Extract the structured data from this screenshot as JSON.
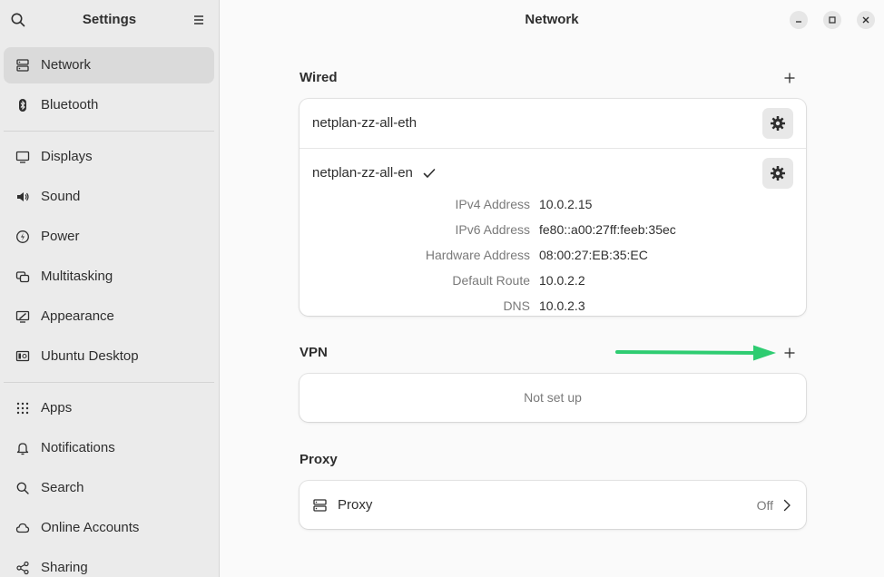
{
  "sidebar": {
    "title": "Settings",
    "search_icon": "search-icon",
    "menu_icon": "hamburger-menu-icon",
    "group1": [
      {
        "label": "Network",
        "icon": "network-icon",
        "active": true
      },
      {
        "label": "Bluetooth",
        "icon": "bluetooth-icon",
        "active": false
      }
    ],
    "group2": [
      {
        "label": "Displays",
        "icon": "display-icon"
      },
      {
        "label": "Sound",
        "icon": "speaker-icon"
      },
      {
        "label": "Power",
        "icon": "power-icon"
      },
      {
        "label": "Multitasking",
        "icon": "multitasking-icon"
      },
      {
        "label": "Appearance",
        "icon": "appearance-icon"
      },
      {
        "label": "Ubuntu Desktop",
        "icon": "ubuntu-desktop-icon"
      }
    ],
    "group3": [
      {
        "label": "Apps",
        "icon": "apps-grid-icon"
      },
      {
        "label": "Notifications",
        "icon": "bell-icon"
      },
      {
        "label": "Search",
        "icon": "search-icon"
      },
      {
        "label": "Online Accounts",
        "icon": "cloud-icon"
      },
      {
        "label": "Sharing",
        "icon": "share-icon"
      }
    ]
  },
  "main": {
    "title": "Network",
    "window_controls": [
      "minimize-icon",
      "maximize-icon",
      "close-icon"
    ],
    "wired": {
      "title": "Wired",
      "connections": [
        {
          "name": "netplan-zz-all-eth",
          "active": false
        },
        {
          "name": "netplan-zz-all-en",
          "active": true
        }
      ],
      "details": [
        {
          "label": "IPv4 Address",
          "value": "10.0.2.15"
        },
        {
          "label": "IPv6 Address",
          "value": "fe80::a00:27ff:feeb:35ec"
        },
        {
          "label": "Hardware Address",
          "value": "08:00:27:EB:35:EC"
        },
        {
          "label": "Default Route",
          "value": "10.0.2.2"
        },
        {
          "label": "DNS",
          "value": "10.0.2.3"
        }
      ]
    },
    "vpn": {
      "title": "VPN",
      "empty_text": "Not set up"
    },
    "proxy": {
      "title": "Proxy",
      "row_label": "Proxy",
      "status": "Off"
    }
  },
  "colors": {
    "annotation_arrow": "#2ecc71",
    "sidebar_bg": "#ebebeb",
    "main_bg": "#fafafa",
    "active_item": "#dadada"
  }
}
